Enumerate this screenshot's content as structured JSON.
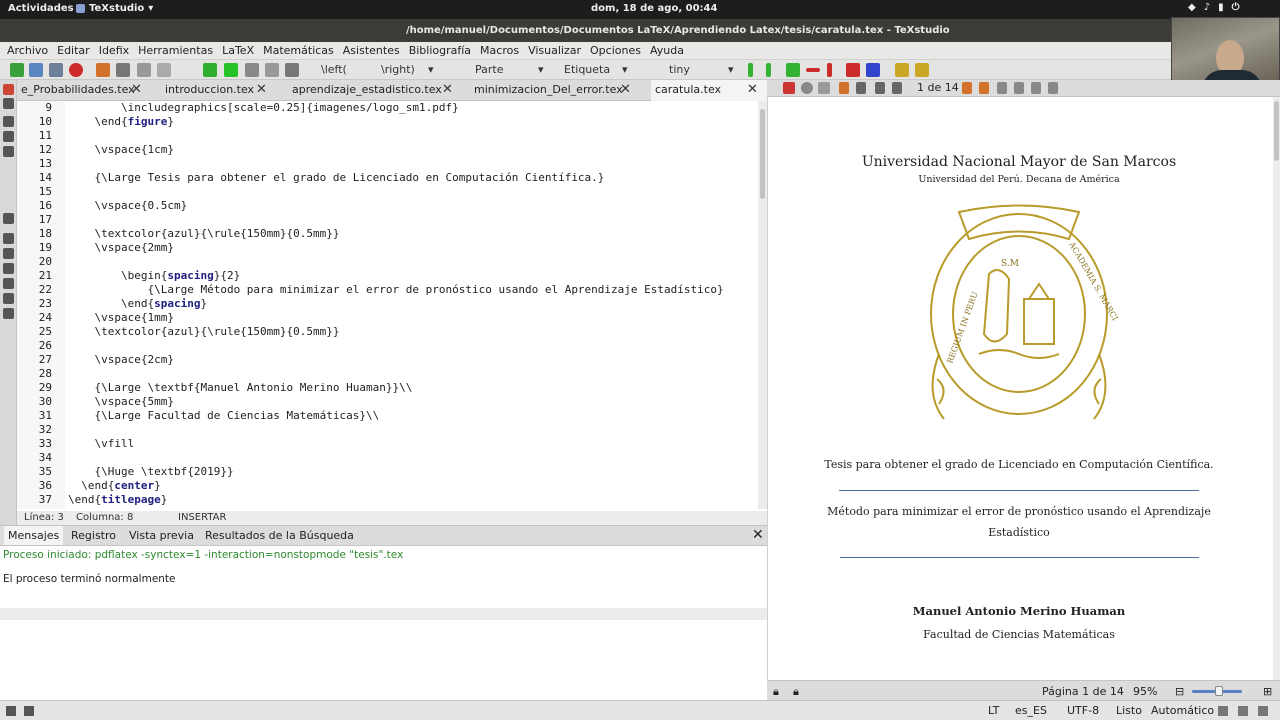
{
  "topbar": {
    "activities": "Actividades",
    "app_name": "TeXstudio",
    "clock": "dom, 18 de ago, 00:44"
  },
  "window": {
    "title": "/home/manuel/Documentos/Documentos LaTeX/Aprendiendo Latex/tesis/caratula.tex - TeXstudio"
  },
  "menu": [
    "Archivo",
    "Editar",
    "Idefix",
    "Herramientas",
    "LaTeX",
    "Matemáticas",
    "Asistentes",
    "Bibliografía",
    "Macros",
    "Visualizar",
    "Opciones",
    "Ayuda"
  ],
  "toolbar": {
    "left_delim": "\\left(",
    "right_delim": "\\right)",
    "section_select": "Parte",
    "label_select": "Etiqueta",
    "size_select": "tiny"
  },
  "tabs": [
    {
      "label": "e_Probabilidades.tex",
      "close": "✕"
    },
    {
      "label": "introduccion.tex",
      "close": "✕"
    },
    {
      "label": "aprendizaje_estadistico.tex",
      "close": "✕"
    },
    {
      "label": "minimizacion_Del_error.tex",
      "close": "✕"
    },
    {
      "label": "caratula.tex",
      "close": "✕"
    }
  ],
  "editor": {
    "line_numbers": [
      "9",
      "10",
      "11",
      "12",
      "13",
      "14",
      "15",
      "16",
      "17",
      "18",
      "19",
      "20",
      "21",
      "22",
      "23",
      "24",
      "25",
      "26",
      "27",
      "28",
      "29",
      "30",
      "31",
      "32",
      "33",
      "34",
      "35",
      "36",
      "37"
    ],
    "lines": [
      "        \\includegraphics[scale=0.25]{imagenes/logo_sm1.pdf}",
      "    \\end{figure}",
      "",
      "    \\vspace{1cm}",
      "",
      "    {\\Large Tesis para obtener el grado de Licenciado en Computación Científica.}",
      "",
      "    \\vspace{0.5cm}",
      "",
      "    \\textcolor{azul}{\\rule{150mm}{0.5mm}}",
      "    \\vspace{2mm}",
      "",
      "        \\begin{spacing}{2}",
      "            {\\Large Método para minimizar el error de pronóstico usando el Aprendizaje Estadístico}",
      "        \\end{spacing}",
      "    \\vspace{1mm}",
      "    \\textcolor{azul}{\\rule{150mm}{0.5mm}}",
      "",
      "    \\vspace{2cm}",
      "",
      "    {\\Large \\textbf{Manuel Antonio Merino Huaman}}\\\\",
      "    \\vspace{5mm}",
      "    {\\Large Facultad de Ciencias Matemáticas}\\\\",
      "",
      "    \\vfill",
      "",
      "    {\\Huge \\textbf{2019}}",
      "  \\end{center}",
      "\\end{titlepage}"
    ],
    "status_line": "Línea: 3",
    "status_col": "Columna: 8",
    "status_mode": "INSERTAR"
  },
  "messages": {
    "tabs": [
      "Mensajes",
      "Registro",
      "Vista previa",
      "Resultados de la Búsqueda"
    ],
    "close": "✕",
    "started": "Proceso iniciado: pdflatex -synctex=1 -interaction=nonstopmode \"tesis\".tex",
    "finished": "El proceso terminó normalmente"
  },
  "pdf": {
    "page_field": "1 de 14",
    "university": "Universidad Nacional Mayor de San Marcos",
    "subtitle": "Universidad del Perú. Decana de América",
    "thesis_line": "Tesis para obtener el grado de Licenciado en Computación Científica.",
    "title_line1": "Método para minimizar el error de pronóstico usando el Aprendizaje",
    "title_line2": "Estadístico",
    "author": "Manuel Antonio Merino Huaman",
    "faculty": "Facultad de Ciencias Matemáticas",
    "seal_text_left": "REGIUM IN PERU",
    "seal_text_right": "ACADEMIA S. MARCI",
    "seal_sm": "S.M",
    "status_page": "Página 1 de 14",
    "zoom": "95%"
  },
  "bottom_status": {
    "lang": "es_ES",
    "encoding": "UTF-8",
    "ready": "Listo",
    "mode": "Automático"
  },
  "colors": {
    "accent_rule": "#4a6a9a",
    "seal_gold": "#b89b2a",
    "message_green": "#2e8b2e"
  }
}
